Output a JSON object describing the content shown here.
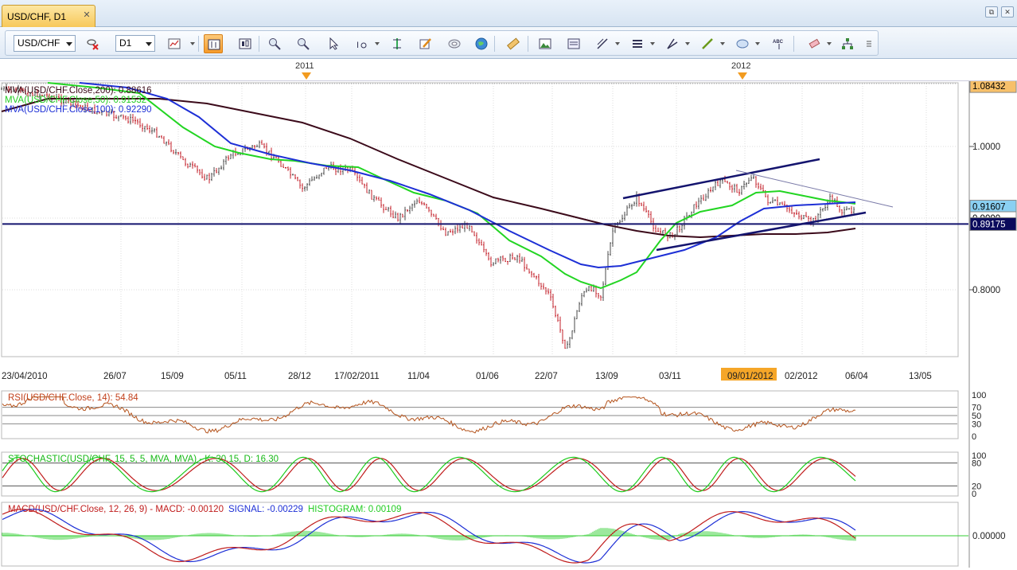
{
  "tab": {
    "title": "USD/CHF, D1",
    "close": "✕"
  },
  "window": {
    "restore": "⧉",
    "close": "✕"
  },
  "toolbar": {
    "symbol": "USD/CHF",
    "timeframe": "D1",
    "active_tool": "chart-style-bars",
    "icons": [
      "symbol-dropdown-icon",
      "cross-icon",
      "timeframe-dropdown-icon",
      "chart-type-icon",
      "chart-style-bars",
      "chart-style-candles",
      "zoom-in-icon",
      "zoom-out-icon",
      "crosshair-icon",
      "text-icon",
      "period-separator-icon",
      "edit-icon",
      "layers-icon",
      "globe-icon",
      "ruler-icon",
      "image-icon",
      "template-icon",
      "fib-icon",
      "lines-icon",
      "channel-icon",
      "pen-icon",
      "shape-icon",
      "abc-icon",
      "eraser-icon",
      "network-icon",
      "more-icon"
    ]
  },
  "timebar": {
    "years": [
      {
        "label": "2011"
      },
      {
        "label": "2012"
      }
    ]
  },
  "main_chart": {
    "indicators": [
      {
        "label": "MVA(USD/CHF.Close,200): 0.88616",
        "color": "#3a0a18"
      },
      {
        "label": "MVA(USD/CHF.Close,50): 0.91532",
        "color": "#22cc22"
      },
      {
        "label": "MVA(USD/CHF.Close,100): 0.92290",
        "color": "#1d2fd6"
      }
    ],
    "y_ticks": [
      {
        "label": "1.0000",
        "v": 1.0
      },
      {
        "label": "0.8000",
        "v": 0.8
      }
    ],
    "price_tags": [
      {
        "label": "1.08432",
        "v": 1.08432,
        "bg": "#f7c06a",
        "fg": "#000"
      },
      {
        "label": "0.91607",
        "v": 0.91607,
        "bg": "#8ad0f2",
        "fg": "#000"
      },
      {
        "label": "0.9000",
        "v": 0.9,
        "bg": "#ffffff",
        "fg": "#000"
      },
      {
        "label": "0.89175",
        "v": 0.89175,
        "bg": "#0a0a5c",
        "fg": "#ffffff"
      }
    ],
    "x_ticks": [
      {
        "label": "23/04/2010"
      },
      {
        "label": "26/07"
      },
      {
        "label": "15/09"
      },
      {
        "label": "05/11"
      },
      {
        "label": "28/12"
      },
      {
        "label": "17/02/2011"
      },
      {
        "label": "11/04"
      },
      {
        "label": "01/06"
      },
      {
        "label": "22/07"
      },
      {
        "label": "13/09"
      },
      {
        "label": "03/11"
      },
      {
        "label": "09/01/2012"
      },
      {
        "label": "02/2012"
      },
      {
        "label": "06/04"
      },
      {
        "label": "13/05"
      }
    ],
    "horizontal_line": 0.89175
  },
  "rsi": {
    "label": "RSI(USD/CHF.Close, 14): 54.84",
    "levels": [
      "100",
      "70",
      "50",
      "30",
      "0"
    ]
  },
  "stochastic": {
    "label": "STOCHASTIC(USD/CHF, 15, 5, 5, MVA, MVA) - K: 30.15, D: 16.30",
    "levels": [
      "100",
      "80",
      "20",
      "0"
    ]
  },
  "macd": {
    "label_main": "MACD(USD/CHF.Close, 12, 26, 9) -  MACD: -0.00120",
    "label_signal": "SIGNAL: -0.00229",
    "label_hist": "HISTOGRAM: 0.00109",
    "levels": [
      "0.00000"
    ]
  },
  "colors": {
    "accent": "#f7b53d",
    "grid": "#dcdcdc",
    "bull": "#555",
    "bear": "#c0202a"
  }
}
